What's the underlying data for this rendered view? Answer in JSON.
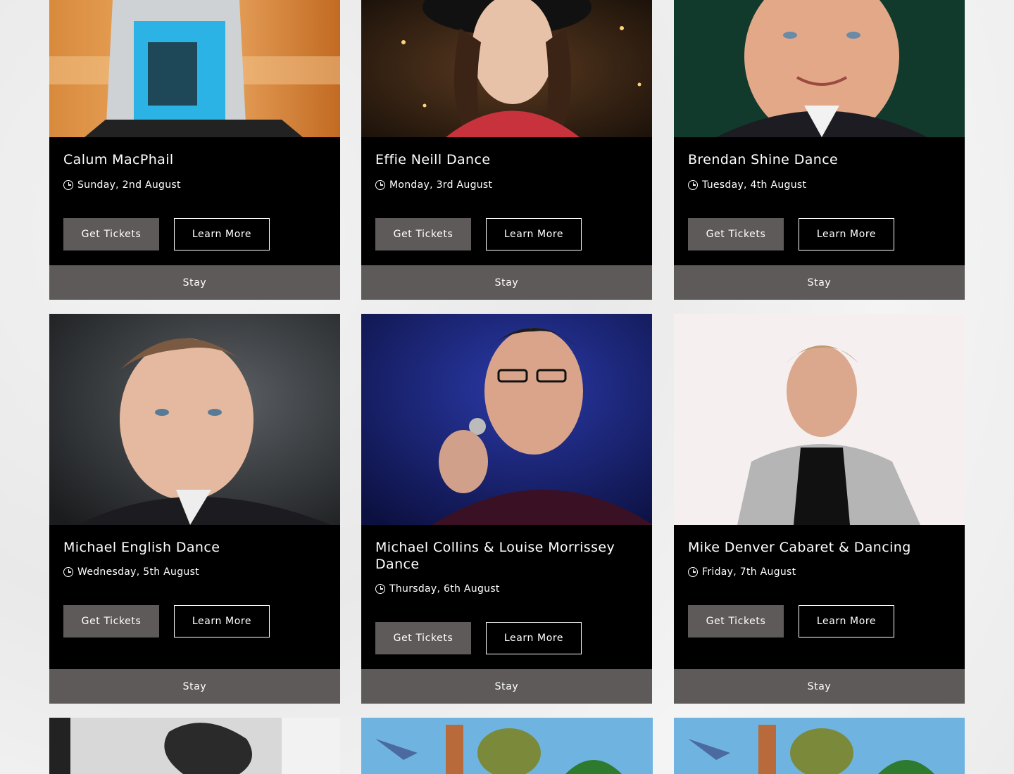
{
  "events": [
    {
      "title": "Calum MacPhail",
      "date": "Sunday, 2nd August",
      "tickets": "Get Tickets",
      "learn": "Learn More",
      "stay": "Stay"
    },
    {
      "title": "Effie Neill Dance",
      "date": "Monday, 3rd August",
      "tickets": "Get Tickets",
      "learn": "Learn More",
      "stay": "Stay"
    },
    {
      "title": "Brendan Shine Dance",
      "date": "Tuesday, 4th August",
      "tickets": "Get Tickets",
      "learn": "Learn More",
      "stay": "Stay"
    },
    {
      "title": "Michael English Dance",
      "date": "Wednesday, 5th August",
      "tickets": "Get Tickets",
      "learn": "Learn More",
      "stay": "Stay"
    },
    {
      "title": "Michael Collins & Louise Morrissey Dance",
      "date": "Thursday, 6th August",
      "tickets": "Get Tickets",
      "learn": "Learn More",
      "stay": "Stay"
    },
    {
      "title": "Mike Denver Cabaret & Dancing",
      "date": "Friday, 7th August",
      "tickets": "Get Tickets",
      "learn": "Learn More",
      "stay": "Stay"
    }
  ],
  "colors": {
    "card_bg": "#000000",
    "button_grey": "#5f5a5a",
    "text": "#ffffff"
  }
}
